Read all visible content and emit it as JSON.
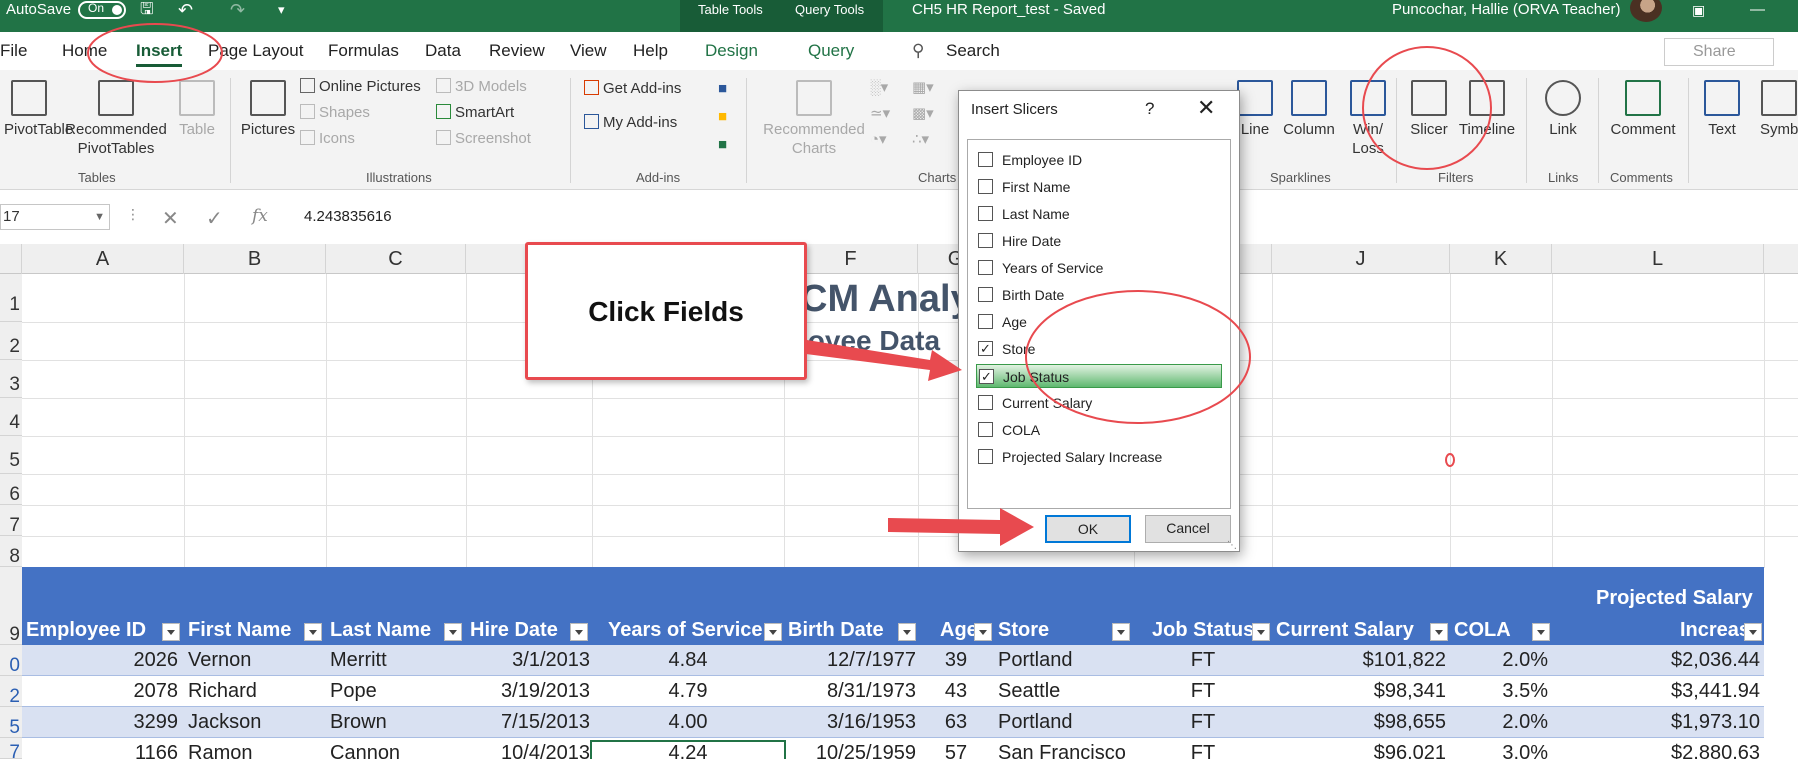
{
  "titlebar": {
    "autosave_label": "AutoSave",
    "autosave_state": "On",
    "context_tab_1": "Table Tools",
    "context_tab_2": "Query Tools",
    "doc_title": "CH5 HR Report_test - Saved",
    "user": "Puncochar, Hallie (ORVA Teacher)"
  },
  "tabs": [
    "File",
    "Home",
    "Insert",
    "Page Layout",
    "Formulas",
    "Data",
    "Review",
    "View",
    "Help",
    "Design",
    "Query"
  ],
  "search_label": "Search",
  "share_label": "Share",
  "ribbon": {
    "pivottable": "PivotTable",
    "recommended_pivot": "Recommended PivotTables",
    "table": "Table",
    "tables_group": "Tables",
    "pictures": "Pictures",
    "online_pictures": "Online Pictures",
    "shapes": "Shapes",
    "icons": "Icons",
    "models_3d": "3D Models",
    "smartart": "SmartArt",
    "screenshot": "Screenshot",
    "illustrations_group": "Illustrations",
    "get_addins": "Get Add-ins",
    "my_addins": "My Add-ins",
    "addins_group": "Add-ins",
    "recommended_charts": "Recommended Charts",
    "charts_group": "Charts",
    "line": "Line",
    "column": "Column",
    "winloss": "Win/ Loss",
    "sparklines_group": "Sparklines",
    "slicer": "Slicer",
    "timeline": "Timeline",
    "filters_group": "Filters",
    "link": "Link",
    "links_group": "Links",
    "comment": "Comment",
    "comments_group": "Comments",
    "text": "Text",
    "symbols": "Symb"
  },
  "formula_bar": {
    "name_box": "17",
    "value": "4.243835616"
  },
  "columns": [
    "A",
    "B",
    "C",
    "",
    "",
    "F",
    "G",
    "",
    "",
    "J",
    "K",
    "L"
  ],
  "rows": [
    "1",
    "2",
    "3",
    "4",
    "5",
    "6",
    "7",
    "8",
    "9",
    "0",
    "2",
    "5",
    "7"
  ],
  "sheet_title_1": "CM Analy",
  "sheet_title_2": "loyee Data",
  "table_headers": [
    "Employee ID",
    "First Name",
    "Last Name",
    "Hire Date",
    "Years of Service",
    "Birth Date",
    "Age",
    "Store",
    "Job Status",
    "Current Salary",
    "COLA",
    "Projected Salary",
    "Increas"
  ],
  "table_rows": [
    [
      "2026",
      "Vernon",
      "Merritt",
      "3/1/2013",
      "4.84",
      "12/7/1977",
      "39",
      "Portland",
      "FT",
      "$101,822",
      "2.0%",
      "$2,036.44"
    ],
    [
      "2078",
      "Richard",
      "Pope",
      "3/19/2013",
      "4.79",
      "8/31/1973",
      "43",
      "Seattle",
      "FT",
      "$98,341",
      "3.5%",
      "$3,441.94"
    ],
    [
      "3299",
      "Jackson",
      "Brown",
      "7/15/2013",
      "4.00",
      "3/16/1953",
      "63",
      "Portland",
      "FT",
      "$98,655",
      "2.0%",
      "$1,973.10"
    ],
    [
      "1166",
      "Ramon",
      "Cannon",
      "10/4/2013",
      "4.24",
      "10/25/1959",
      "57",
      "San Francisco",
      "FT",
      "$96,021",
      "3.0%",
      "$2,880.63"
    ]
  ],
  "callout": "Click Fields",
  "dialog": {
    "title": "Insert Slicers",
    "help": "?",
    "close": "✕",
    "fields": [
      {
        "label": "Employee ID",
        "checked": false
      },
      {
        "label": "First Name",
        "checked": false
      },
      {
        "label": "Last Name",
        "checked": false
      },
      {
        "label": "Hire Date",
        "checked": false
      },
      {
        "label": "Years of Service",
        "checked": false
      },
      {
        "label": "Birth Date",
        "checked": false
      },
      {
        "label": "Age",
        "checked": false
      },
      {
        "label": "Store",
        "checked": true
      },
      {
        "label": "Job Status",
        "checked": true
      },
      {
        "label": "Current Salary",
        "checked": false
      },
      {
        "label": "COLA",
        "checked": false
      },
      {
        "label": "Projected Salary Increase",
        "checked": false
      }
    ],
    "ok": "OK",
    "cancel": "Cancel"
  },
  "colors": {
    "excel_green": "#217346",
    "table_header": "#4472c4",
    "band": "#d9e1f2",
    "annotation_red": "#e84a4f"
  }
}
